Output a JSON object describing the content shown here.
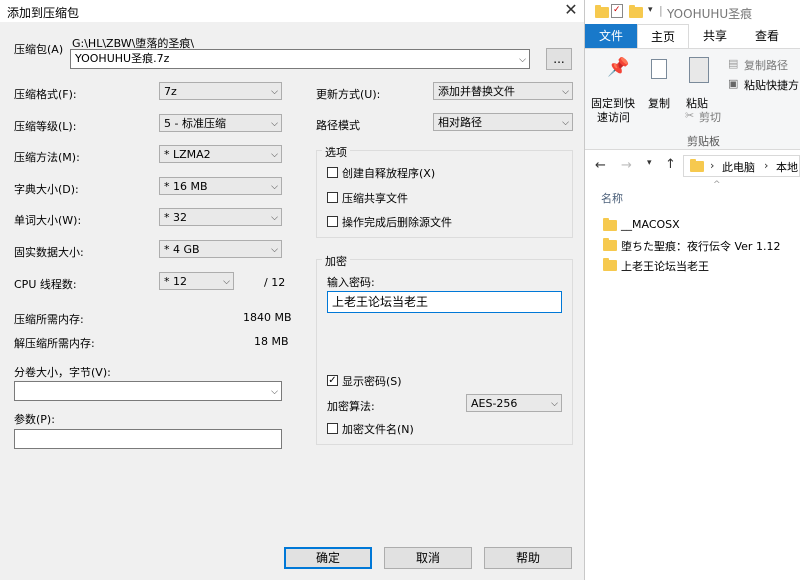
{
  "dialog": {
    "title": "添加到压缩包",
    "archive_label": "压缩包(A)",
    "archive_path": "G:\\HL\\ZBW\\堕落的圣痕\\",
    "archive_name": "YOOHUHU圣痕.7z",
    "browse_label": "...",
    "left": [
      {
        "label": "压缩格式(F):",
        "value": "7z"
      },
      {
        "label": "压缩等级(L):",
        "value": "5 - 标准压缩"
      },
      {
        "label": "压缩方法(M):",
        "value": "* LZMA2"
      },
      {
        "label": "字典大小(D):",
        "value": "* 16 MB"
      },
      {
        "label": "单词大小(W):",
        "value": "* 32"
      },
      {
        "label": "固实数据大小:",
        "value": "* 4 GB"
      },
      {
        "label": "CPU 线程数:",
        "value": "* 12"
      }
    ],
    "cpu_total": "/ 12",
    "mem_compress_label": "压缩所需内存:",
    "mem_compress_value": "1840 MB",
    "mem_decompress_label": "解压缩所需内存:",
    "mem_decompress_value": "18 MB",
    "volume_label": "分卷大小，字节(V):",
    "volume_value": "",
    "params_label": "参数(P):",
    "params_value": "",
    "update_label": "更新方式(U):",
    "update_value": "添加并替换文件",
    "path_label": "路径模式",
    "path_value": "相对路径",
    "options_title": "选项",
    "options": [
      {
        "label": "创建自释放程序(X)",
        "checked": false
      },
      {
        "label": "压缩共享文件",
        "checked": false
      },
      {
        "label": "操作完成后删除源文件",
        "checked": false
      }
    ],
    "encrypt_title": "加密",
    "password_label": "输入密码:",
    "password_value": "上老王论坛当老王",
    "show_password_label": "显示密码(S)",
    "show_password_checked": true,
    "encrypt_method_label": "加密算法:",
    "encrypt_method_value": "AES-256",
    "encrypt_names_label": "加密文件名(N)",
    "encrypt_names_checked": false,
    "ok_label": "确定",
    "cancel_label": "取消",
    "help_label": "帮助",
    "check_mark": "✓"
  },
  "explorer": {
    "window_title": "YOOHUHU圣痕",
    "tabs": [
      "文件",
      "主页",
      "共享",
      "查看"
    ],
    "pin_label_1": "固定到快",
    "pin_label_2": "速访问",
    "copy_label": "复制",
    "paste_label": "粘贴",
    "copy_path_label": "复制路径",
    "paste_shortcut_label": "粘贴快捷方",
    "cut_label": "剪切",
    "clipboard_group": "剪贴板",
    "breadcrumb": [
      "此电脑",
      "本地"
    ],
    "column_name": "名称",
    "files": [
      "__MACOSX",
      "堕ちた聖痕：夜行伝令 Ver 1.12",
      "上老王论坛当老王"
    ],
    "accent": "#1979ca"
  }
}
